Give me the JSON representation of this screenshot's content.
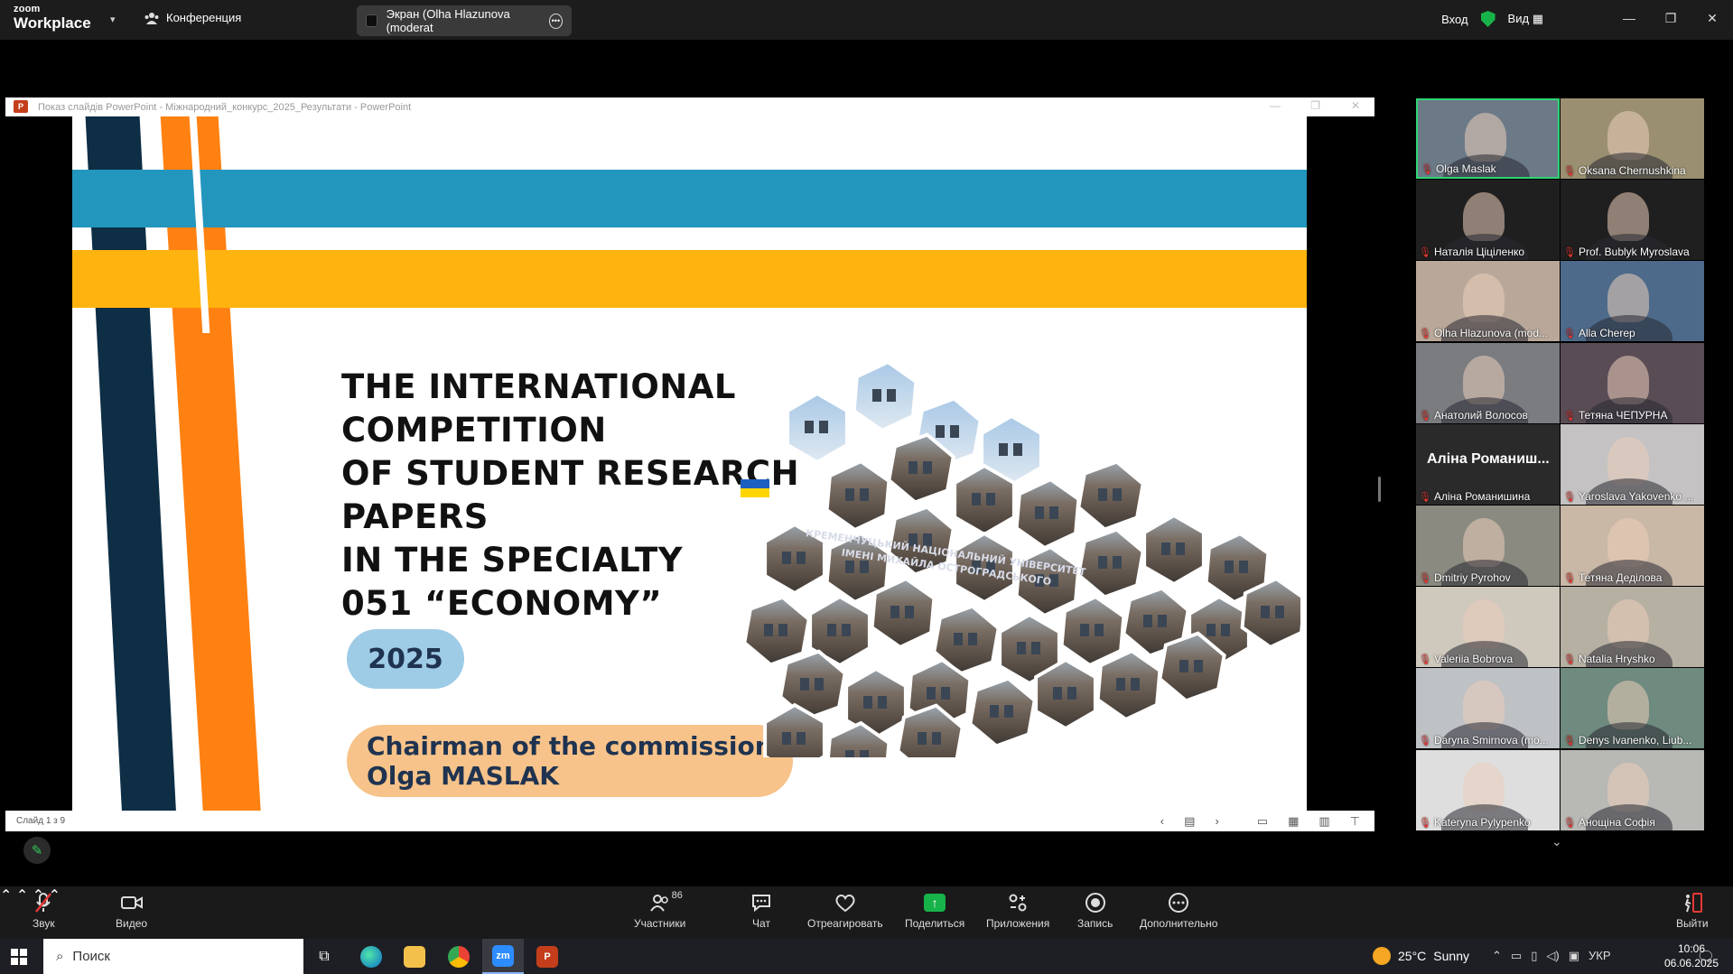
{
  "zoom": {
    "logo_line1": "zoom",
    "logo_line2": "Workplace",
    "conference_label": "Конференция",
    "screen_share_label": "Экран (Olha Hlazunova (moderat",
    "signin_label": "Вход",
    "view_label": "Вид"
  },
  "ppt": {
    "window_title": "Показ слайдів PowerPoint  -  Міжнародний_конкурс_2025_Результати - PowerPoint",
    "status_slide": "Слайд 1 з 9",
    "slide": {
      "title_lines": [
        "THE INTERNATIONAL",
        "COMPETITION",
        "OF STUDENT RESEARCH",
        "PAPERS",
        "IN THE SPECIALTY",
        "051 “ECONOMY”"
      ],
      "year": "2025",
      "chair_line1": "Chairman of the commission:",
      "chair_line2": "Olga MASLAK",
      "building_sign_line1": "КРЕМЕНЧУЦЬКИЙ НАЦІОНАЛЬНИЙ УНІВЕРСИТЕТ",
      "building_sign_line2": "ІМЕНІ МИХАЙЛА ОСТРОГРАДСЬКОГО"
    }
  },
  "gallery": {
    "participants": [
      {
        "name": "Olga Maslak",
        "active": true,
        "color": "#6c7a88"
      },
      {
        "name": "Oksana Chernushkina",
        "active": false,
        "color": "#9a9071"
      },
      {
        "name": "Наталія Ціціленко",
        "active": false,
        "color": "#1f1f1f"
      },
      {
        "name": "Prof. Bublyk Myroslava",
        "active": false,
        "color": "#1f1f1f"
      },
      {
        "name": "Olha Hlazunova (mod...",
        "active": false,
        "color": "#b9a89a"
      },
      {
        "name": "Alla Cherep",
        "active": false,
        "color": "#4d6a8a"
      },
      {
        "name": "Анатолий Волосов",
        "active": false,
        "color": "#7a7c80"
      },
      {
        "name": "Тетяна ЧЕПУРНА",
        "active": false,
        "color": "#5a4c55"
      },
      {
        "name": "Аліна Романишина",
        "active": false,
        "color": "#2a2a2a",
        "big": "Аліна Романиш..."
      },
      {
        "name": "Yaroslava Yakovenko ...",
        "active": false,
        "color": "#c4c2c2"
      },
      {
        "name": "Dmitriy Pyrohov",
        "active": false,
        "color": "#8a8a80"
      },
      {
        "name": "Тетяна Деділова",
        "active": false,
        "color": "#c9b8a6"
      },
      {
        "name": "Valeriia Bobrova",
        "active": false,
        "color": "#cfc8bc"
      },
      {
        "name": "Natalia Hryshko",
        "active": false,
        "color": "#b6b0a3"
      },
      {
        "name": "Daryna Smirnova (mo...",
        "active": false,
        "color": "#bfc2c5"
      },
      {
        "name": "Denys Ivanenko, Liub...",
        "active": false,
        "color": "#6f8a7f"
      },
      {
        "name": "Kateryna Pylypenko",
        "active": false,
        "color": "#dedede"
      },
      {
        "name": "Анощіна Софія",
        "active": false,
        "color": "#b8b8b5"
      }
    ]
  },
  "toolbar": {
    "audio": "Звук",
    "video": "Видео",
    "participants": "Участники",
    "participants_count": "86",
    "chat": "Чат",
    "react": "Отреагировать",
    "share": "Поделиться",
    "apps": "Приложения",
    "record": "Запись",
    "more": "Дополнительно",
    "leave": "Выйти"
  },
  "taskbar": {
    "search_placeholder": "Поиск",
    "weather_temp": "25°C",
    "weather_desc": "Sunny",
    "language": "УКР",
    "time": "10:06",
    "date": "06.06.2025"
  },
  "colors": {
    "zoom_green": "#17b34a",
    "active_tile_border": "#2ed573",
    "stripe_teal": "#2396be",
    "stripe_yellow": "#ffb30f",
    "stripe_navy": "#0d2e45",
    "stripe_orange": "#ff8112"
  }
}
